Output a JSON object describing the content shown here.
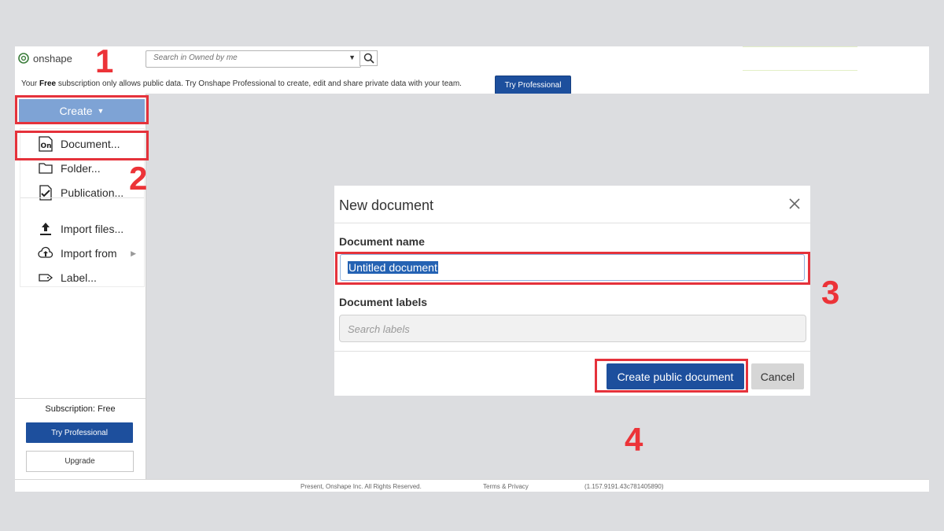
{
  "app": {
    "logo_text": "onshape",
    "search_placeholder": "Search in Owned by me"
  },
  "banner": {
    "text_prefix": "Your ",
    "text_bold": "Free",
    "text_suffix": " subscription only allows public data. Try Onshape Professional to create, edit and share private data with your team.",
    "try_professional_label": "Try Professional"
  },
  "sidebar": {
    "create_label": "Create",
    "menu_items": [
      {
        "label": "Document...",
        "icon": "onshape-document-icon"
      },
      {
        "label": "Folder...",
        "icon": "folder-icon"
      },
      {
        "label": "Publication...",
        "icon": "publication-icon"
      },
      {
        "label": "Import files...",
        "icon": "upload-icon"
      },
      {
        "label": "Import from",
        "icon": "cloud-upload-icon"
      },
      {
        "label": "Label...",
        "icon": "label-icon"
      }
    ],
    "subscription_label": "Subscription: Free",
    "try_professional_label": "Try Professional",
    "upgrade_label": "Upgrade"
  },
  "modal": {
    "title": "New document",
    "document_name_label": "Document name",
    "document_name_value": "Untitled document",
    "document_labels_label": "Document labels",
    "labels_placeholder": "Search labels",
    "create_button_label": "Create public document",
    "cancel_button_label": "Cancel"
  },
  "footer": {
    "copyright": "Present, Onshape Inc. All Rights Reserved.",
    "terms": "Terms & Privacy",
    "version": "(1.157.9191.43c781405890)"
  },
  "annotations": {
    "step_1": "1",
    "step_2": "2",
    "step_3": "3",
    "step_4": "4",
    "color": "#e5323b"
  }
}
